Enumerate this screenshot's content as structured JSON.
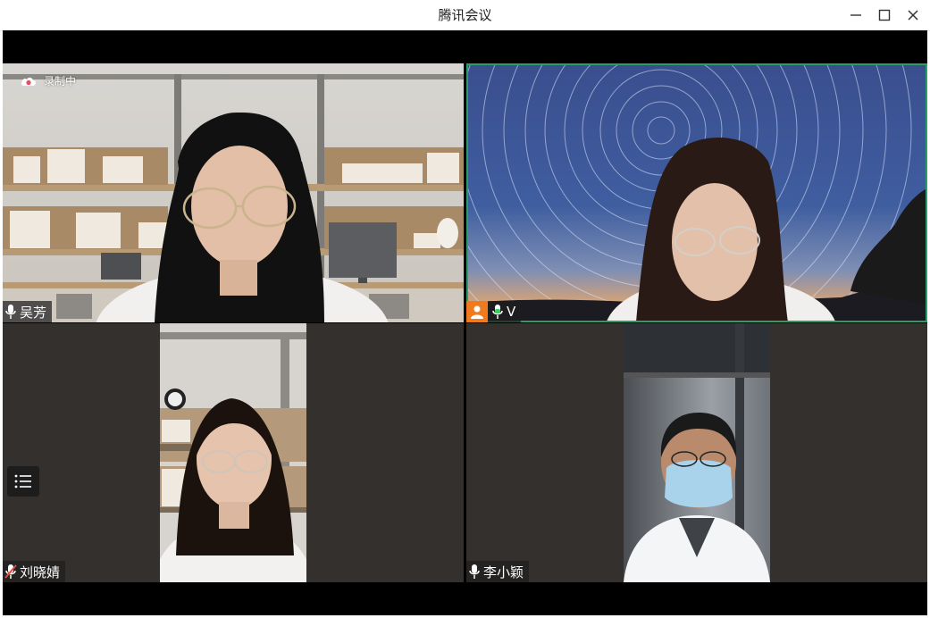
{
  "window": {
    "title": "腾讯会议",
    "controls": [
      "minimize",
      "maximize",
      "close"
    ]
  },
  "meeting": {
    "recording_label": "录制中",
    "participants": [
      {
        "name": "吴芳",
        "mic": "on"
      },
      {
        "name": "V",
        "mic": "speaking",
        "avatar": "person-icon"
      },
      {
        "name": "刘晓婧",
        "mic": "muted"
      },
      {
        "name": "李小颖",
        "mic": "on"
      }
    ]
  },
  "colors": {
    "active_border": "#2a9d6a",
    "avatar_badge": "#f07b1f",
    "tile_background": "#34302d",
    "mic_speaking": "#3ccf5e",
    "mic_muted": "#e5483b"
  }
}
